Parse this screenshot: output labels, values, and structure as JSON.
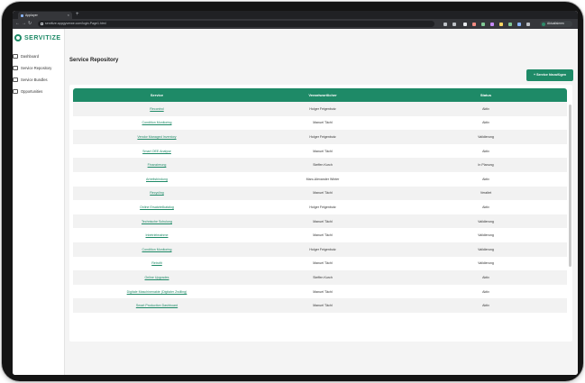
{
  "browser": {
    "tab_title": "Applayer",
    "url": "servitize.appgyverwe.com/login-Page1.html",
    "profile_label": "Aktualisieren"
  },
  "app": {
    "brand": "SERVITIZE",
    "nav": [
      {
        "label": "Dashboard",
        "icon": "dashboard-icon"
      },
      {
        "label": "Service Repository",
        "icon": "repository-icon"
      },
      {
        "label": "Service Bundles",
        "icon": "bundles-icon"
      },
      {
        "label": "Opportunities",
        "icon": "opportunities-icon"
      }
    ],
    "page_title": "Service Repository",
    "add_button": "+ Service hinzufügen",
    "colors": {
      "accent": "#1e8a67"
    }
  },
  "table": {
    "headers": [
      "Service",
      "Verantwortlicher",
      "Status"
    ],
    "rows": [
      {
        "service": "Recontrol",
        "owner": "Holger Feigenbutz",
        "status": "Aktiv"
      },
      {
        "service": "Condition Monitoring",
        "owner": "Manuel Tächl",
        "status": "Aktiv"
      },
      {
        "service": "Vendor Managed Inventory",
        "owner": "Holger Feigenbutz",
        "status": "Validierung"
      },
      {
        "service": "Smart OEE Analyse",
        "owner": "Manuel Tächl",
        "status": "Aktiv"
      },
      {
        "service": "Finanzierung",
        "owner": "Steffen Kurch",
        "status": "In Planung"
      },
      {
        "service": "Arbeitsbindung",
        "owner": "Marc-Alexander Winter",
        "status": "Aktiv"
      },
      {
        "service": "Recycling",
        "owner": "Manuel Tächl",
        "status": "Veraltet"
      },
      {
        "service": "Online Ersatzteilkatalog",
        "owner": "Holger Feigenbutz",
        "status": "Aktiv"
      },
      {
        "service": "Technische Schulung",
        "owner": "Manuel Tächl",
        "status": "Validierung"
      },
      {
        "service": "Inbetriebnahme",
        "owner": "Manuel Tächl",
        "status": "Validierung"
      },
      {
        "service": "Condition Monitoring",
        "owner": "Holger Feigenbutz",
        "status": "Validierung"
      },
      {
        "service": "Retrofit",
        "owner": "Manuel Tächl",
        "status": "Validierung"
      },
      {
        "service": "Online Upgrades",
        "owner": "Steffen Kurch",
        "status": "Aktiv"
      },
      {
        "service": "Digitale Maschinenakte (Digitaler Zwilling)",
        "owner": "Manuel Tächl",
        "status": "Aktiv"
      },
      {
        "service": "Smart Production Dashboard",
        "owner": "Manuel Tächl",
        "status": "Aktiv"
      }
    ]
  }
}
